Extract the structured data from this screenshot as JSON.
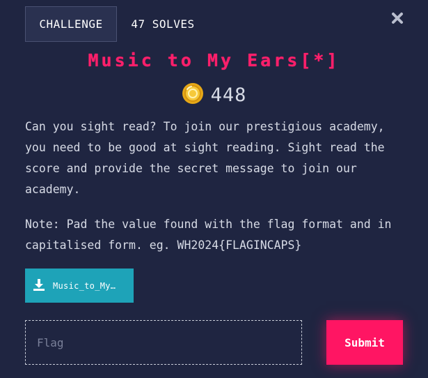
{
  "tabs": {
    "challenge_label": "CHALLENGE",
    "solves_label": "47 SOLVES"
  },
  "challenge": {
    "title": "Music to My Ears[*]",
    "points": "448",
    "description": [
      "Can you sight read? To join our prestigious academy, you need to be good at sight reading. Sight read the score and provide the secret message to join our academy.",
      "Note: Pad the value found with the flag format and in capitalised form. eg. WH2024{FLAGINCAPS}"
    ],
    "file_label": "Music_to_My…"
  },
  "form": {
    "flag_placeholder": "Flag",
    "submit_label": "Submit"
  },
  "icons": {
    "close": "close-icon",
    "coin": "coin-icon",
    "download": "download-icon"
  },
  "colors": {
    "background": "#1f2541",
    "accent": "#ff1f6b",
    "download": "#1ea3b8",
    "submit": "#ff1563"
  }
}
